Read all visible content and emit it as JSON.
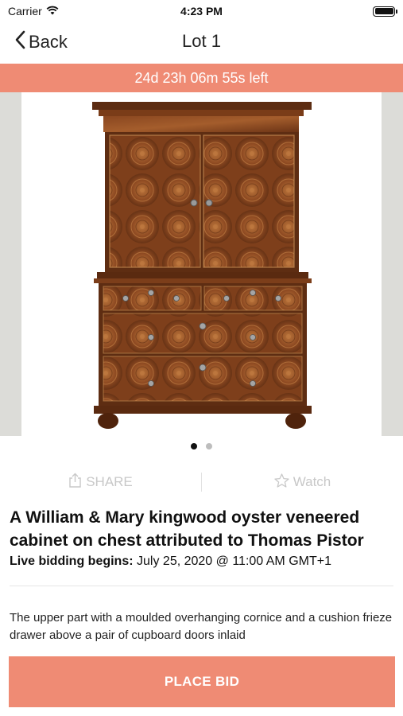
{
  "status_bar": {
    "carrier": "Carrier",
    "time": "4:23 PM"
  },
  "nav": {
    "back_label": "Back",
    "title": "Lot 1"
  },
  "countdown": {
    "text": "24d 23h 06m 55s left",
    "color": "#ef8b74"
  },
  "gallery": {
    "image_subject": "walnut-oyster-veneered-cabinet-on-chest",
    "page_count": 2,
    "active_page": 1
  },
  "actions": {
    "share_label": "SHARE",
    "share_icon": "share-icon",
    "watch_label": "Watch",
    "watch_icon": "star-icon"
  },
  "lot": {
    "title": "A William & Mary kingwood oyster veneered cabinet on chest attributed to Thomas Pistor",
    "bidding_label": "Live bidding begins:",
    "bidding_value": "July 25, 2020 @ 11:00 AM GMT+1",
    "description": "The upper part with a moulded overhanging cornice and a cushion frieze drawer above a pair of cupboard doors inlaid"
  },
  "cta": {
    "place_bid_label": "PLACE BID",
    "color": "#ef8b74"
  }
}
